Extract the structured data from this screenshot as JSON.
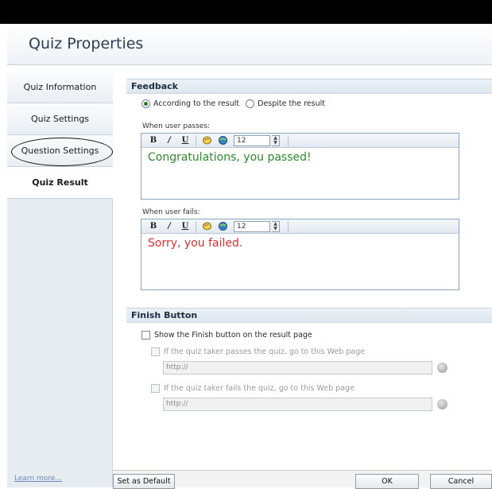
{
  "window": {
    "title": "Quiz Properties"
  },
  "sidebar": {
    "items": [
      {
        "label": "Quiz Information"
      },
      {
        "label": "Quiz Settings"
      },
      {
        "label": "Question Settings"
      },
      {
        "label": "Quiz Result"
      }
    ],
    "learn_more": "Learn more..."
  },
  "feedback": {
    "header": "Feedback",
    "radio_result": "According to the result",
    "radio_despite": "Despite the result",
    "pass_label": "When user passes:",
    "pass_text": "Congratulations, you passed!",
    "fail_label": "When user fails:",
    "fail_text": "Sorry, you failed.",
    "font_size": "12",
    "colors": {
      "pass": "#2e8b2e",
      "fail": "#e03030"
    }
  },
  "finish": {
    "header": "Finish Button",
    "show_finish": "Show the Finish button on the result page",
    "pass_option": "If the quiz taker passes the quiz, go to this Web page",
    "pass_url": "http://",
    "fail_option": "If the quiz taker fails the quiz, go to this Web page",
    "fail_url": "http://"
  },
  "buttons": {
    "set_default": "Set as Default",
    "ok": "OK",
    "cancel": "Cancel"
  }
}
